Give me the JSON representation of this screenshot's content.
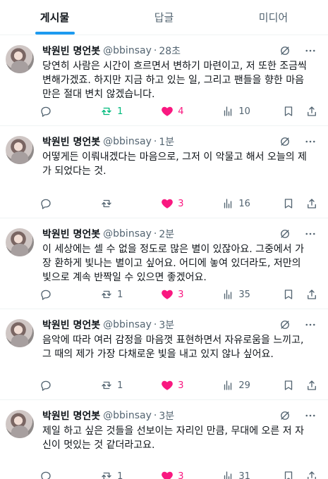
{
  "tabs": [
    {
      "label": "게시물",
      "active": true
    },
    {
      "label": "답글",
      "active": false
    },
    {
      "label": "미디어",
      "active": false
    }
  ],
  "tweets": [
    {
      "name": "박원빈 명언봇",
      "handle": "@bbinsay",
      "time": "28초",
      "text": "당연히 사람은 시간이 흐르면서 변하기 마련이고, 저 또한 조금씩 변해가겠죠. 하지만 지금 하고 있는 일, 그리고 팬들을 향한 마음만은 절대 변치 않겠습니다.",
      "replies": "",
      "reposts": "1",
      "likes": "4",
      "views": "10",
      "reposted": true
    },
    {
      "name": "박원빈 명언봇",
      "handle": "@bbinsay",
      "time": "1분",
      "text": "어떻게든 이뤄내겠다는 마음으로, 그저 이 악물고 해서 오늘의 제가 되었다는 것.",
      "replies": "",
      "reposts": "",
      "likes": "3",
      "views": "16",
      "reposted": false
    },
    {
      "name": "박원빈 명언봇",
      "handle": "@bbinsay",
      "time": "2분",
      "text": "이 세상에는 셀 수 없을 정도로 많은 별이 있잖아요. 그중에서 가장 환하게 빛나는 별이고 싶어요. 어디에 놓여 있더라도, 저만의 빛으로 계속 반짝일 수 있으면 좋겠어요.",
      "replies": "",
      "reposts": "1",
      "likes": "3",
      "views": "35",
      "reposted": false
    },
    {
      "name": "박원빈 명언봇",
      "handle": "@bbinsay",
      "time": "3분",
      "text": "음악에 따라 여러 감정을 마음껏 표현하면서 자유로움을 느끼고, 그 때의 제가 가장 다채로운 빛을 내고 있지 않나 싶어요.",
      "replies": "",
      "reposts": "1",
      "likes": "3",
      "views": "29",
      "reposted": false
    },
    {
      "name": "박원빈 명언봇",
      "handle": "@bbinsay",
      "time": "3분",
      "text": "제일 하고 싶은 것들을 선보이는 자리인 만큼, 무대에 오른 저 자신이 멋있는 것 같더라고요.",
      "replies": "",
      "reposts": "1",
      "likes": "3",
      "views": "31",
      "reposted": false
    }
  ],
  "colors": {
    "accent": "#1d9bf0",
    "like": "#f91880",
    "repost": "#00ba7c",
    "muted": "#536471"
  },
  "icons": [
    "grok-icon",
    "more-icon",
    "reply-icon",
    "repost-icon",
    "like-icon",
    "views-icon",
    "bookmark-icon",
    "share-icon"
  ]
}
